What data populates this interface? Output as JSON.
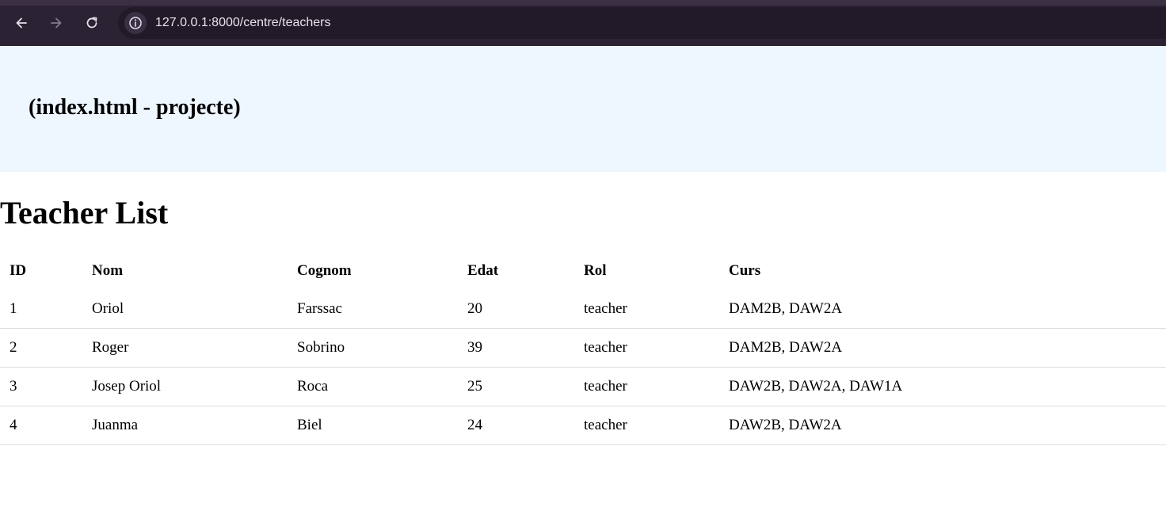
{
  "browser": {
    "url": "127.0.0.1:8000/centre/teachers"
  },
  "header": {
    "project_title": "(index.html - projecte)"
  },
  "main": {
    "title": "Teacher List",
    "table": {
      "columns": [
        "ID",
        "Nom",
        "Cognom",
        "Edat",
        "Rol",
        "Curs"
      ],
      "rows": [
        [
          "1",
          "Oriol",
          "Farssac",
          "20",
          "teacher",
          "DAM2B, DAW2A"
        ],
        [
          "2",
          "Roger",
          "Sobrino",
          "39",
          "teacher",
          "DAM2B, DAW2A"
        ],
        [
          "3",
          "Josep Oriol",
          "Roca",
          "25",
          "teacher",
          "DAW2B, DAW2A, DAW1A"
        ],
        [
          "4",
          "Juanma",
          "Biel",
          "24",
          "teacher",
          "DAW2B, DAW2A"
        ]
      ]
    }
  }
}
